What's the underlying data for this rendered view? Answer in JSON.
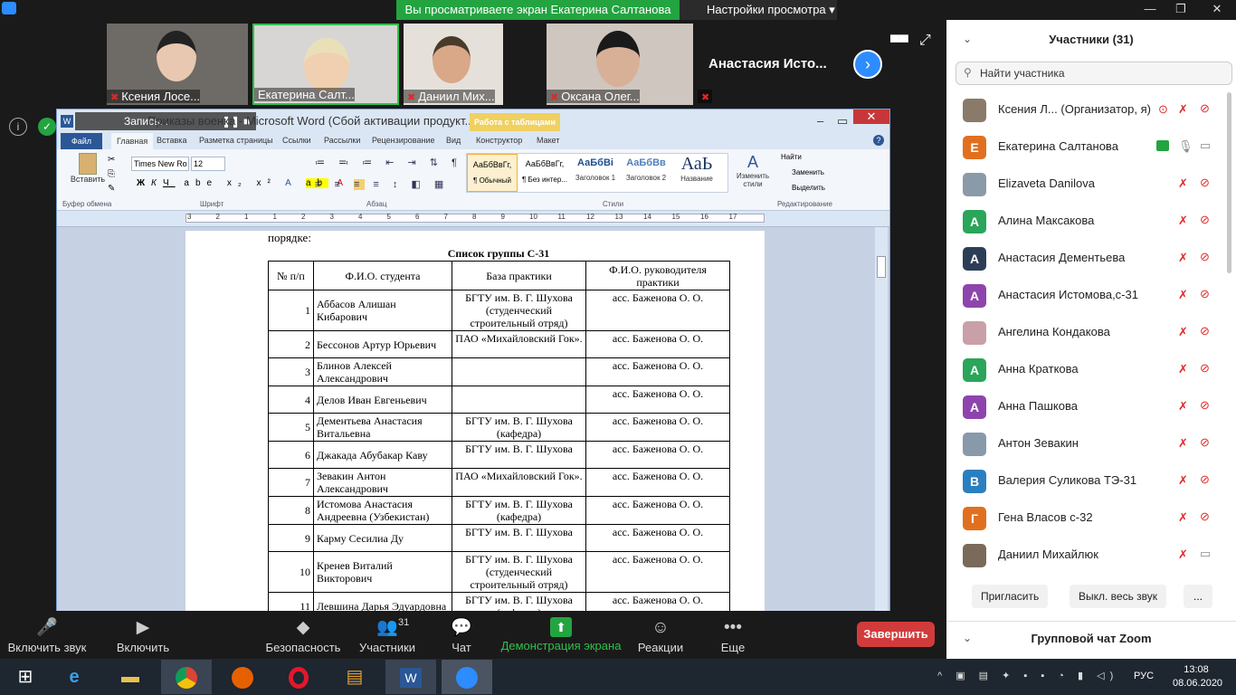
{
  "zoom": {
    "banner": "Вы просматриваете экран Екатерина Салтанова",
    "view_options": "Настройки просмотра",
    "thumbnails": [
      {
        "name": "Ксения Лосе...",
        "muted": true
      },
      {
        "name": "Екатерина Салт...",
        "muted": false
      },
      {
        "name": "Даниил Мих...",
        "muted": true
      },
      {
        "name": "Оксана Олег...",
        "muted": true
      },
      {
        "name": "",
        "muted": true
      }
    ],
    "overflow_name": "Анастасия  Исто...",
    "record_label": "Запись..."
  },
  "word": {
    "title": "Приказы военка  -  Microsoft Word (Сбой активации продукт...",
    "context_tab": "Работа с таблицами",
    "tabs": [
      "Файл",
      "Главная",
      "Вставка",
      "Разметка страницы",
      "Ссылки",
      "Рассылки",
      "Рецензирование",
      "Вид",
      "Конструктор",
      "Макет"
    ],
    "font_name": "Times New Ro",
    "font_size": "12",
    "paste_label": "Вставить",
    "groups": [
      "Буфер обмена",
      "Шрифт",
      "Абзац",
      "Стили",
      "Редактирование"
    ],
    "styles": [
      {
        "preview": "АаБбВвГг,",
        "label": "¶ Обычный"
      },
      {
        "preview": "АаБбВвГг,",
        "label": "¶ Без интер..."
      },
      {
        "preview": "АаБбВі",
        "label": "Заголовок 1"
      },
      {
        "preview": "АаБбВв",
        "label": "Заголовок 2"
      },
      {
        "preview": "АаЬ",
        "label": "Название"
      }
    ],
    "change_styles": "Изменить стили",
    "edit_items": [
      "Найти",
      "Заменить",
      "Выделить"
    ],
    "ruler_numbers": [
      "3",
      "2",
      "1",
      "1",
      "2",
      "3",
      "4",
      "5",
      "6",
      "7",
      "8",
      "9",
      "10",
      "11",
      "12",
      "13",
      "14",
      "15",
      "16",
      "17"
    ],
    "doc_prefix": "порядке:",
    "table_title": "Список группы С-31",
    "headers": [
      "№ п/п",
      "Ф.И.О. студента",
      "База практики",
      "Ф.И.О. руководителя практики"
    ],
    "rows": [
      {
        "n": "1",
        "student": "Аббасов Алишан Кибарович",
        "base": "БГТУ им. В. Г. Шухова (студенческий строительный отряд)",
        "head": "асс. Баженова О. О."
      },
      {
        "n": "2",
        "student": "Бессонов Артур Юрьевич",
        "base": "ПАО «Михайловский Гок».",
        "head": "асс. Баженова О. О."
      },
      {
        "n": "3",
        "student": "Блинов Алексей Александрович",
        "base": "",
        "head": "асс. Баженова О. О."
      },
      {
        "n": "4",
        "student": "Делов Иван Евгеньевич",
        "base": "",
        "head": "асс. Баженова О. О."
      },
      {
        "n": "5",
        "student": "Дементьева Анастасия Витальевна",
        "base": "БГТУ им. В. Г. Шухова (кафедра)",
        "head": "асс. Баженова О. О."
      },
      {
        "n": "6",
        "student": "Джакада Абубакар Каву",
        "base": "БГТУ им. В. Г. Шухова",
        "head": "асс. Баженова О. О."
      },
      {
        "n": "7",
        "student": "Зевакин Антон Александрович",
        "base": "ПАО «Михайловский Гок».",
        "head": "асс. Баженова О. О."
      },
      {
        "n": "8",
        "student": "Истомова Анастасия Андреевна (Узбекистан)",
        "base": "БГТУ им. В. Г. Шухова (кафедра)",
        "head": "асс. Баженова О. О."
      },
      {
        "n": "9",
        "student": "Карму Сесилиа Ду",
        "base": "БГТУ им. В. Г. Шухова",
        "head": "асс. Баженова О. О."
      },
      {
        "n": "10",
        "student": "Кренев Виталий Викторович",
        "base": "БГТУ им. В. Г. Шухова (студенческий строительный отряд)",
        "head": "асс. Баженова О. О."
      },
      {
        "n": "11",
        "student": "Левшина Дарья Эдуардовна",
        "base": "БГТУ им. В. Г. Шухова (кафедра)",
        "head": "асс. Баженова О. О."
      }
    ]
  },
  "panel": {
    "title": "Участники (31)",
    "search_placeholder": "Найти участника",
    "participants": [
      {
        "name": "Ксения Л...  (Организатор, я)",
        "initial": "",
        "color": "#8a7a6a"
      },
      {
        "name": "Екатерина Салтанова",
        "initial": "Е",
        "color": "#e0701f"
      },
      {
        "name": "Elizaveta Danilova",
        "initial": "",
        "color": "#8a9aa8"
      },
      {
        "name": "Алина Максакова",
        "initial": "А",
        "color": "#2aa55a"
      },
      {
        "name": "Анастасия Дементьева",
        "initial": "А",
        "color": "#2c3e57"
      },
      {
        "name": "Анастасия Истомова,с-31",
        "initial": "А",
        "color": "#8e44ad"
      },
      {
        "name": "Ангелина Кондакова",
        "initial": "",
        "color": "#c9a0a8"
      },
      {
        "name": "Анна Краткова",
        "initial": "А",
        "color": "#2aa55a"
      },
      {
        "name": "Анна Пашкова",
        "initial": "А",
        "color": "#8e44ad"
      },
      {
        "name": "Антон Зевакин",
        "initial": "",
        "color": "#8899aa"
      },
      {
        "name": "Валерия Суликова ТЭ-31",
        "initial": "В",
        "color": "#2a7fc0"
      },
      {
        "name": "Гена Власов с-32",
        "initial": "Г",
        "color": "#e0701f"
      },
      {
        "name": "Даниил Михайлюк",
        "initial": "",
        "color": "#7a6a5a"
      }
    ],
    "invite": "Пригласить",
    "mute_all": "Выкл. весь звук",
    "more": "...",
    "chat_title": "Групповой чат Zoom"
  },
  "toolbar": {
    "items": [
      {
        "label": "Включить звук",
        "glyph": "🎤"
      },
      {
        "label": "Включить видео",
        "glyph": "▶"
      },
      {
        "label": "Безопасность",
        "glyph": "◆"
      },
      {
        "label": "Участники",
        "glyph": "👥",
        "count": "31"
      },
      {
        "label": "Чат",
        "glyph": "💬"
      },
      {
        "label": "Демонстрация экрана",
        "glyph": "⬆"
      },
      {
        "label": "Реакции",
        "glyph": "☺"
      },
      {
        "label": "Еще",
        "glyph": "•••"
      }
    ],
    "end": "Завершить"
  },
  "taskbar": {
    "lang": "РУС",
    "time": "13:08",
    "date": "08.06.2020"
  }
}
